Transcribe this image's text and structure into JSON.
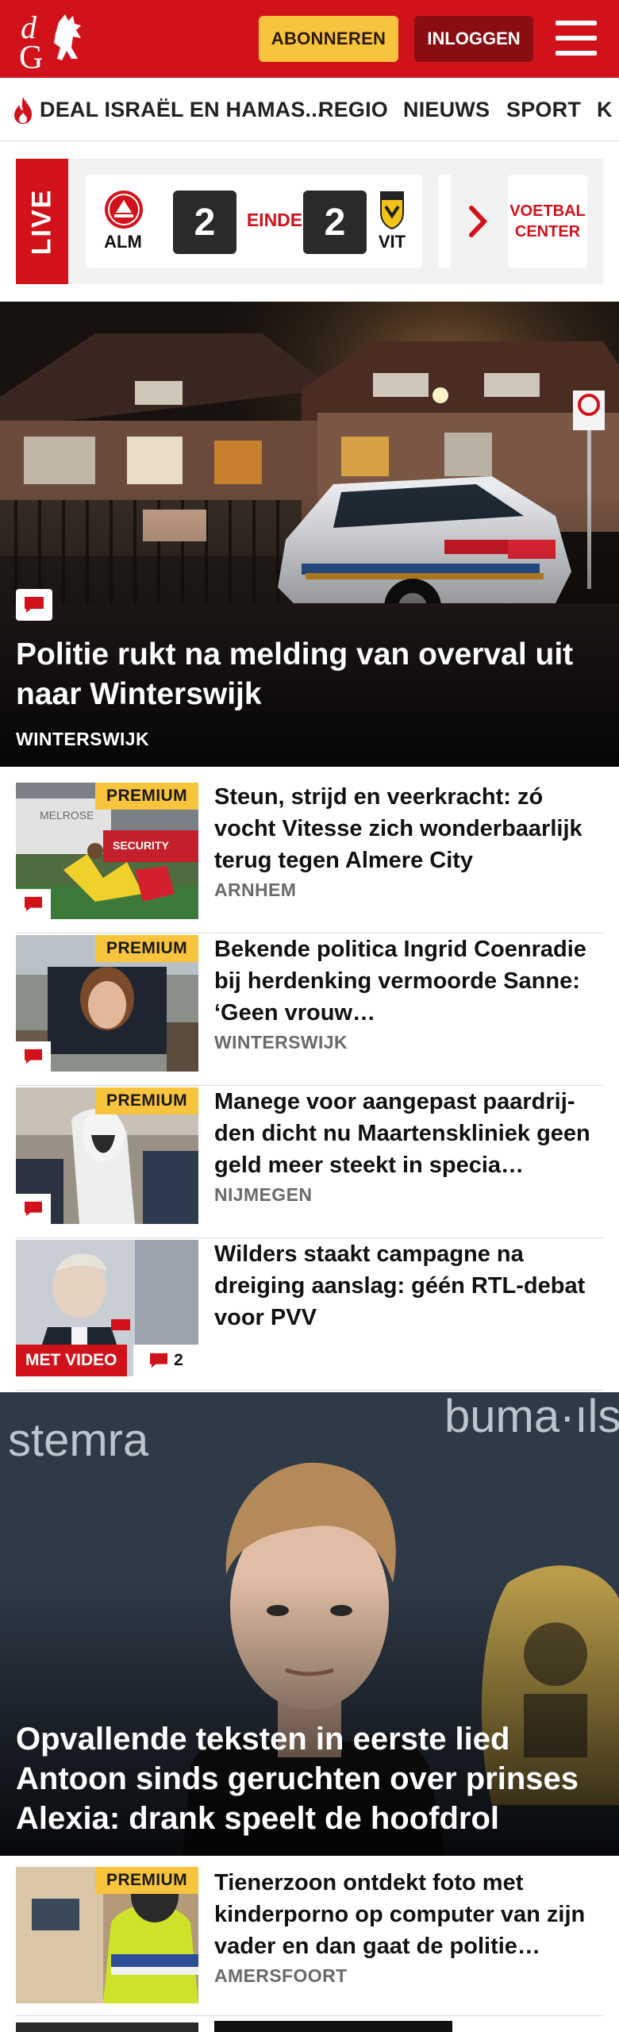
{
  "header": {
    "logo_alt": "dG",
    "subscribe_label": "ABONNEREN",
    "login_label": "INLOGGEN",
    "brand_color": "#d2121b"
  },
  "nav": {
    "items": [
      {
        "label": "DEAL ISRAËL EN HAMAS...",
        "hot": true
      },
      {
        "label": "REGIO"
      },
      {
        "label": "NIEUWS"
      },
      {
        "label": "SPORT"
      },
      {
        "label": "K"
      }
    ]
  },
  "live": {
    "label": "LIVE",
    "match": {
      "home_team": "ALM",
      "away_team": "VIT",
      "home_score": "2",
      "away_score": "2",
      "status": "EINDE"
    },
    "voetbal_center_label": "VOETBAL\nCENTER"
  },
  "hero": {
    "title": "Politie rukt na melding van overval uit naar Winterswijk",
    "location": "WINTERSWIJK",
    "has_comments": true
  },
  "articles": [
    {
      "title": "Steun, strijd en veerkracht: zó vocht Vitesse zich wonderbaar­lijk terug tegen Almere City",
      "location": "ARNHEM",
      "premium_label": "PREMIUM",
      "has_comments": true
    },
    {
      "title": "Bekende politica Ingrid Coenradie bij herdenking vermoorde Sanne: ‘Geen vrouw…",
      "location": "WINTERSWIJK",
      "premium_label": "PREMIUM",
      "has_comments": true
    },
    {
      "title": "Manege voor aangepast paardrij­den dicht nu Maartenskliniek geen geld meer steekt in specia…",
      "location": "NIJMEGEN",
      "premium_label": "PREMIUM",
      "has_comments": true
    },
    {
      "title": "Wilders staakt campagne na dreiging aanslag: géén RTL-debat voor PVV",
      "video_label": "MET VIDEO",
      "comment_count": "2"
    }
  ],
  "feature": {
    "title": "Opvallende teksten in eerste lied Antoon sinds geruchten over prinses Alexia: drank speelt de hoofdrol"
  },
  "articles_bottom": [
    {
      "title": "Tienerzoon ontdekt foto met kinderporno op computer van zijn vader en dan gaat de politie…",
      "location": "AMERSFOORT",
      "premium_label": "PREMIUM"
    }
  ]
}
